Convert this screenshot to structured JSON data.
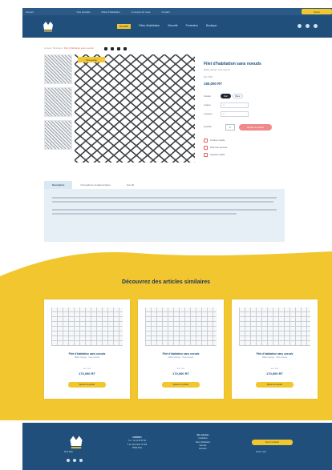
{
  "colors": {
    "brand_navy": "#1f4f7a",
    "accent_yellow": "#f2c62e",
    "accent_red": "#e35d5d",
    "panel_blue": "#e6eff5"
  },
  "topbar": {
    "items": [
      "Accueil",
      "Nos produits",
      "Filets d'habitation",
      "À propos de nous",
      "Contact"
    ],
    "cta": "Devis"
  },
  "nav": {
    "links": [
      "Accueil",
      "Filets d'habitation",
      "Sécurité",
      "Protection",
      "Boutique"
    ],
    "icons": [
      "search-icon",
      "heart-icon",
      "cart-icon"
    ]
  },
  "breadcrumb": {
    "path": "Accueil / Boutique / ",
    "current": "Filet d'habitation sans noeuds"
  },
  "product": {
    "badge": "Nouveauté",
    "title": "Filet d'habitation sans noeuds",
    "subtitle": "Maille losange, sans noeuds",
    "ref": "Ref. 2500",
    "price": "150,000 RT",
    "options": {
      "label": "Couleur",
      "choice_a": "Noir",
      "choice_b": "Blanc",
      "width_label": "Largeur",
      "length_label": "Longueur",
      "width_placeholder": "m",
      "length_placeholder": "m"
    },
    "qty_label": "Quantité",
    "qty": "1",
    "add_to_cart": "Ajouter au panier",
    "features": [
      "Livraison rapide",
      "Paiement sécurisé",
      "Garantie qualité"
    ]
  },
  "description": {
    "tabs": [
      "Description",
      "Informations complémentaires",
      "Avis (0)"
    ]
  },
  "similar": {
    "title": "Découvrez des articles similaires",
    "cards": [
      {
        "title": "Filet d'habitation sans noeuds",
        "sub": "Maille losange · Sans noeuds",
        "ref": "Réf. 2500",
        "price": "170,000 RT",
        "button": "Ajouter au panier"
      },
      {
        "title": "Filet d'habitation sans noeuds",
        "sub": "Maille losange · Sans noeuds",
        "ref": "Réf. 2500",
        "price": "170,000 RT",
        "button": "Ajouter au panier"
      },
      {
        "title": "Filet d'habitation sans noeuds",
        "sub": "Maille losange · Sans noeuds",
        "ref": "Réf. 2500",
        "price": "170,000 RT",
        "button": "Ajouter au panier"
      }
    ]
  },
  "side_tab": "Retour haut",
  "footer": {
    "brand": "Fil & Filet",
    "contact": {
      "head": "CONTACT",
      "lines": [
        "Tél. : 01 23 45 67 89",
        "5 rue des Filets 75 000",
        "75000 Paris"
      ]
    },
    "links": {
      "head": "Nos services",
      "lines": [
        "Installation",
        "Filets d'habitation",
        "Sécurité",
        "Entretien"
      ]
    },
    "cta": "Nous contacter",
    "cta_small": "Suivez-nous"
  }
}
